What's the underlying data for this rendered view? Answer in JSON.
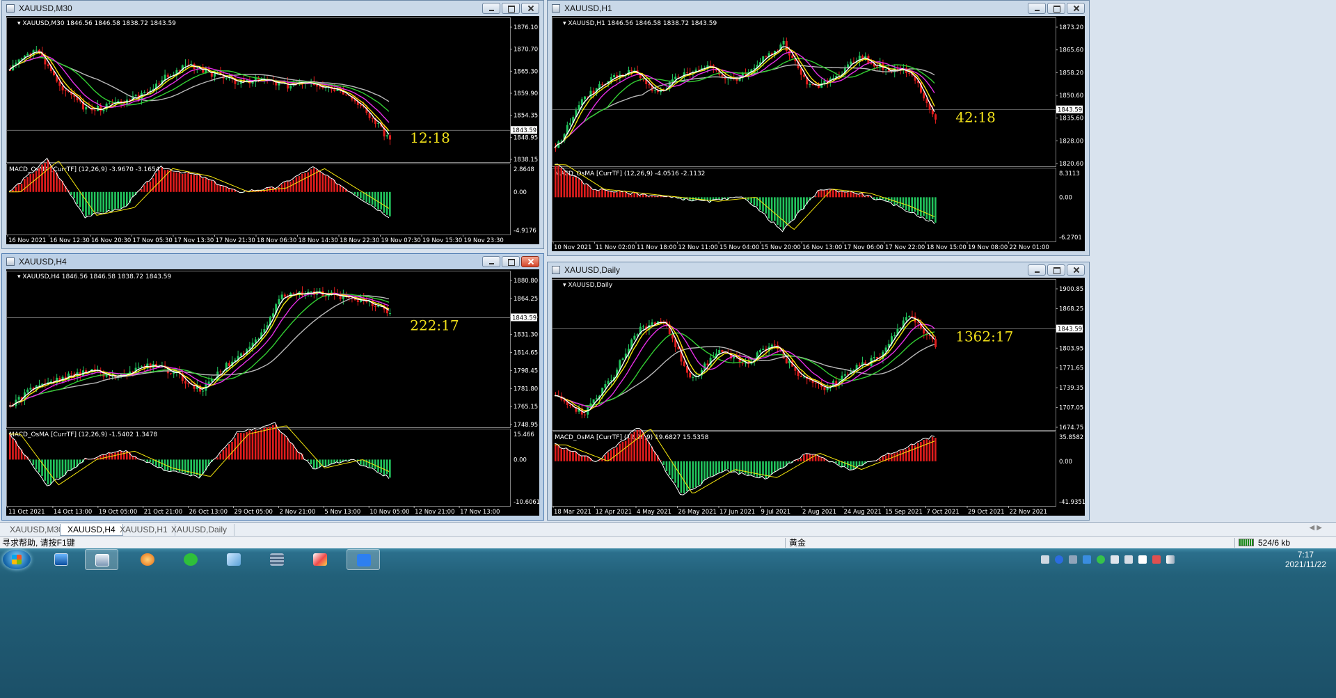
{
  "windows": [
    {
      "id": "m30",
      "title": "XAUUSD,M30",
      "close_hot": false,
      "info": "XAUUSD,M30  1846.56 1846.58 1838.72 1843.59",
      "countdown": "12:18",
      "price_axis": [
        "1876.10",
        "1870.70",
        "1865.30",
        "1859.90",
        "1854.35",
        "1848.95",
        "1838.15"
      ],
      "current_price": "1843.59",
      "macd_label": "MACD_OsMA [CurrTF] (12,26,9) -3.9670 -3.1654",
      "macd_axis": [
        "2.8648",
        "0.00",
        "-4.9176"
      ],
      "time_axis": [
        "16 Nov 2021",
        "16 Nov 12:30",
        "16 Nov 20:30",
        "17 Nov 05:30",
        "17 Nov 13:30",
        "17 Nov 21:30",
        "18 Nov 06:30",
        "18 Nov 14:30",
        "18 Nov 22:30",
        "19 Nov 07:30",
        "19 Nov 15:30",
        "19 Nov 23:30"
      ]
    },
    {
      "id": "h1",
      "title": "XAUUSD,H1",
      "close_hot": false,
      "info": "XAUUSD,H1  1846.56 1846.58 1838.72 1843.59",
      "countdown": "42:18",
      "price_axis": [
        "1873.20",
        "1865.60",
        "1858.20",
        "1850.60",
        "1835.60",
        "1828.00",
        "1820.60"
      ],
      "current_price": "1843.59",
      "macd_label": "MACD_OsMA [CurrTF] (12,26,9) -4.0516 -2.1132",
      "macd_axis": [
        "8.3113",
        "0.00",
        "-6.2701"
      ],
      "time_axis": [
        "10 Nov 2021",
        "11 Nov 02:00",
        "11 Nov 18:00",
        "12 Nov 11:00",
        "15 Nov 04:00",
        "15 Nov 20:00",
        "16 Nov 13:00",
        "17 Nov 06:00",
        "17 Nov 22:00",
        "18 Nov 15:00",
        "19 Nov 08:00",
        "22 Nov 01:00"
      ]
    },
    {
      "id": "h4",
      "title": "XAUUSD,H4",
      "close_hot": true,
      "info": "XAUUSD,H4  1846.56 1846.58 1838.72 1843.59",
      "countdown": "222:17",
      "price_axis": [
        "1880.80",
        "1864.25",
        "1847.95",
        "1831.30",
        "1814.65",
        "1798.45",
        "1781.80",
        "1765.15",
        "1748.95"
      ],
      "current_price": "1843.59",
      "macd_label": "MACD_OsMA [CurrTF] (12,26,9) -1.5402 1.3478",
      "macd_axis": [
        "15.466",
        "0.00",
        "-10.6061"
      ],
      "time_axis": [
        "11 Oct 2021",
        "14 Oct 13:00",
        "19 Oct 05:00",
        "21 Oct 21:00",
        "26 Oct 13:00",
        "29 Oct 05:00",
        "2 Nov 21:00",
        "5 Nov 13:00",
        "10 Nov 05:00",
        "12 Nov 21:00",
        "17 Nov 13:00"
      ]
    },
    {
      "id": "d1",
      "title": "XAUUSD,Daily",
      "close_hot": false,
      "info": "XAUUSD,Daily",
      "countdown": "1362:17",
      "price_axis": [
        "1900.85",
        "1868.25",
        "1836.25",
        "1803.95",
        "1771.65",
        "1739.35",
        "1707.05",
        "1674.75"
      ],
      "current_price": "1843.59",
      "macd_label": "MACD_OsMA [CurrTF] (12,26,9) 19.6827 15.5358",
      "macd_axis": [
        "35.8582",
        "0.00",
        "-41.9351"
      ],
      "time_axis": [
        "18 Mar 2021",
        "12 Apr 2021",
        "4 May 2021",
        "26 May 2021",
        "17 Jun 2021",
        "9 Jul 2021",
        "2 Aug 2021",
        "24 Aug 2021",
        "15 Sep 2021",
        "7 Oct 2021",
        "29 Oct 2021",
        "22 Nov 2021"
      ]
    }
  ],
  "tabs": [
    {
      "label": "XAUUSD,M30",
      "active": false
    },
    {
      "label": "XAUUSD,H4",
      "active": true
    },
    {
      "label": "XAUUSD,H1",
      "active": false
    },
    {
      "label": "XAUUSD,Daily",
      "active": false
    }
  ],
  "status": {
    "help": "寻求帮助, 请按F1键",
    "profile": "黄金",
    "traffic": "524/6 kb"
  },
  "clock": {
    "time": "7:17",
    "date": "2021/11/22"
  },
  "colors": {
    "bull": "#22c55e",
    "bear": "#e11d1d",
    "ma_white": "#ffffff",
    "ma_yellow": "#f5e60c",
    "ma_magenta": "#e62ee6",
    "ma_green": "#32cd32",
    "ma_gray": "#b8b8b8",
    "countdown": "#f2e11a"
  }
}
